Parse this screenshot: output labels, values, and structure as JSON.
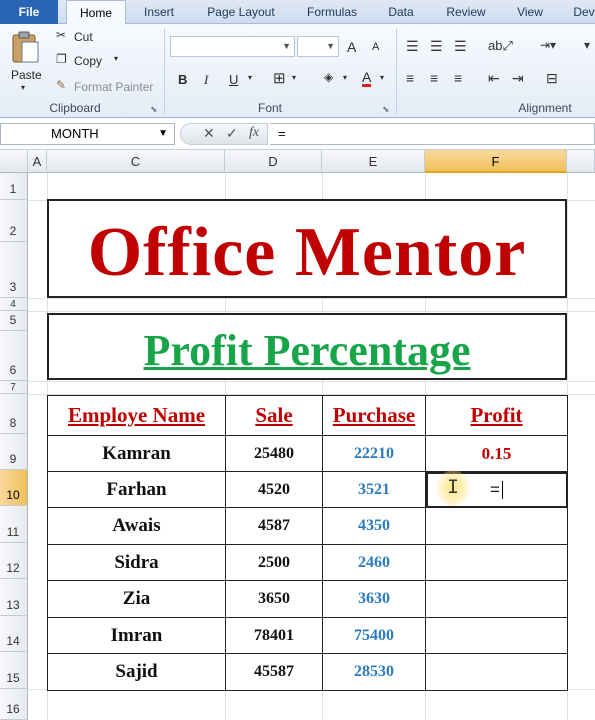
{
  "ribbon": {
    "tabs": [
      "File",
      "Home",
      "Insert",
      "Page Layout",
      "Formulas",
      "Data",
      "Review",
      "View",
      "Dev"
    ],
    "active_tab": "Home",
    "clipboard": {
      "paste": "Paste",
      "cut": "Cut",
      "copy": "Copy",
      "format_painter": "Format Painter",
      "label": "Clipboard"
    },
    "font": {
      "label": "Font",
      "bold": "B",
      "italic": "I",
      "underline": "U",
      "grow": "A",
      "shrink": "A",
      "font_color": "A"
    },
    "alignment": {
      "label": "Alignment"
    }
  },
  "formula_bar": {
    "name_box": "MONTH",
    "cancel": "✕",
    "enter": "✓",
    "fx": "fx",
    "content": "="
  },
  "columns": [
    "A",
    "C",
    "D",
    "E",
    "F"
  ],
  "active_column": "F",
  "rows": [
    "1",
    "2",
    "3",
    "4",
    "5",
    "6",
    "7",
    "8",
    "9",
    "10",
    "11",
    "12",
    "13",
    "14",
    "15",
    "16"
  ],
  "active_row": "10",
  "sheet": {
    "title": "Office Mentor",
    "subtitle": "Profit Percentage",
    "headers": [
      "Employe Name",
      "Sale",
      "Purchase",
      "Profit"
    ],
    "data": [
      {
        "name": "Kamran",
        "sale": "25480",
        "purchase": "22210",
        "profit": "0.15"
      },
      {
        "name": "Farhan",
        "sale": "4520",
        "purchase": "3521",
        "profit": "="
      },
      {
        "name": "Awais",
        "sale": "4587",
        "purchase": "4350",
        "profit": ""
      },
      {
        "name": "Sidra",
        "sale": "2500",
        "purchase": "2460",
        "profit": ""
      },
      {
        "name": "Zia",
        "sale": "3650",
        "purchase": "3630",
        "profit": ""
      },
      {
        "name": "Imran",
        "sale": "78401",
        "purchase": "75400",
        "profit": ""
      },
      {
        "name": "Sajid",
        "sale": "45587",
        "purchase": "28530",
        "profit": ""
      }
    ]
  },
  "colors": {
    "title_red": "#c00000",
    "subtitle_green": "#18a54a",
    "purchase_blue": "#2a7bbf",
    "active_header": "#f0c05b"
  }
}
